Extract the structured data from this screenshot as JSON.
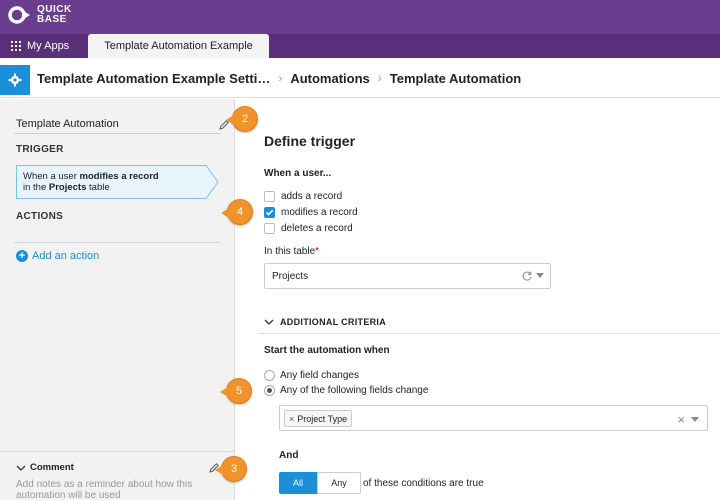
{
  "brand": {
    "logo_line1": "QUICK",
    "logo_line2": "BASE",
    "color": "#6b3d8f"
  },
  "tabbar": {
    "my_apps": "My Apps",
    "active_tab": "Template Automation Example"
  },
  "breadcrumb": {
    "app_settings": "Template Automation Example Setti…",
    "automations": "Automations",
    "current": "Template Automation",
    "separator": "›"
  },
  "left_panel": {
    "automation_name": "Template Automation",
    "trigger_heading": "TRIGGER",
    "trigger_card": {
      "prefix": "When a user ",
      "action": "modifies a record",
      "line2_prefix": "in the ",
      "table": "Projects",
      "line2_suffix": " table"
    },
    "actions_heading": "ACTIONS",
    "add_action": "Add an action",
    "comment_heading": "Comment",
    "comment_placeholder": "Add notes as a reminder about how this automation will be used"
  },
  "callouts": {
    "badge_2": "2",
    "badge_3": "3",
    "badge_4": "4",
    "badge_5": "5",
    "color": "#f0932a"
  },
  "define_trigger": {
    "title": "Define trigger",
    "when_a_user": "When a user...",
    "options": [
      {
        "label": "adds a record",
        "checked": false
      },
      {
        "label": "modifies a record",
        "checked": true
      },
      {
        "label": "deletes a record",
        "checked": false
      }
    ],
    "in_this_table": "In this table",
    "required_mark": "*",
    "table_value": "Projects"
  },
  "additional_criteria": {
    "heading": "ADDITIONAL CRITERIA",
    "start_when": "Start the automation when",
    "radio_options": [
      {
        "label": "Any field changes",
        "selected": false
      },
      {
        "label": "Any of the following fields change",
        "selected": true
      }
    ],
    "selected_fields": [
      "Project Type"
    ],
    "and_label": "And",
    "segment_all": "All",
    "segment_any": "Any",
    "conditions_text": "of these conditions are true"
  },
  "colors": {
    "accent_blue": "#1b8fd8",
    "tabbar": "#5a2f7a"
  }
}
